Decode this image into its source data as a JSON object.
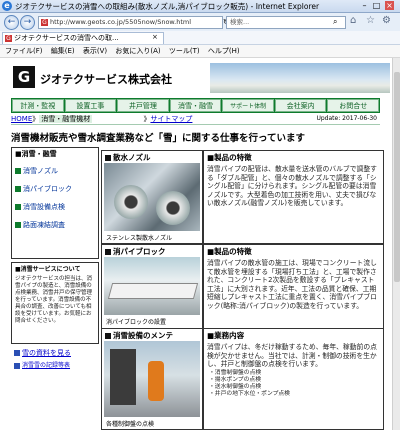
{
  "window": {
    "title": "ジオテクサービスの消雪への取組み(散水ノズル,消パイブロック販売) - Internet Explorer",
    "tab_title": "ジオテクサービスの消雪への取...",
    "controls": [
      "minimize-icon",
      "maximize-icon",
      "close-icon"
    ]
  },
  "address": {
    "url": "http://www.geots.co.jp/5505now/Snow.html",
    "search_placeholder": "検索..."
  },
  "menu": [
    "ファイル(F)",
    "編集(E)",
    "表示(V)",
    "お気に入り(A)",
    "ツール(T)",
    "ヘルプ(H)"
  ],
  "site": {
    "logo": "G",
    "company": "ジオテクサービス株式会社",
    "nav": [
      "計測・監視",
      "設置工事",
      "井戸管理",
      "消雪・融雪",
      "サポート体制",
      "会社案内",
      "お問合せ"
    ],
    "crumb_home": "HOME",
    "crumb_sep": "》",
    "crumb_current": "消雪・融雪機材",
    "crumb_sitemap": "サイトマップ",
    "update": "Update: 2017-06-30",
    "headline": "消雪機材販売や雪水調査業務など「雪」に関する仕事を行っています"
  },
  "side": {
    "heading": "■消雪・融雪",
    "links": [
      "消雪ノズル",
      "消パイブロック",
      "消雪設備点検",
      "路面凍結調査"
    ],
    "about_heading": "■消雪サービスについて",
    "about_text": "ジオテクサービスの担当は、消雪パイプの製造と、消雪設備の点検業務、消雪井戸の保守管理を行っています。消雪設備の不具合の調査、改善についても相談を受けています。お気軽にお問合せください。",
    "links_bottom": [
      "雪の資料を見る",
      "消雪雪の記録等表"
    ]
  },
  "main": {
    "blocks": [
      {
        "caption": "散水ノズル",
        "img_caption": "ステンレス製散水ノズル",
        "heading": "■製品の特徴",
        "text": "消雪パイプの配管は、散水量を送水管のバルブで調整する「ダブル配管」と、個々の散水ノズルで調整する「シングル配管」に分けられます。シングル配管の要は消雪ノズルです。大型着色の加工技術を用い、丈夫で損びない散水ノズル(融雪ノズル)を販売しています。"
      },
      {
        "caption": "消パイブロック",
        "img_caption": "消パイブロックの設置",
        "heading": "■製品の特徴",
        "text": "消雪パイプの散水管の施工は、現場でコンクリート流して散水管を埋設する「現場打ち工法」と、工場で製作された、コンクリート2次製品を敷設する「プレキャスト工法」に大別されます。近年、工法の品質と確保、工期短縮しプレキャスト工法に重点を置く、消雪パイプブロック(略称:消パイブロック)の製造を行っています。"
      },
      {
        "caption": "消雪設備のメンテ",
        "img_caption": "各種制御盤の点検",
        "heading": "■業務内容",
        "text": "消雪パイプは、冬だけ稼動するため、毎年、稼動前の点検が欠かせません。当社では、計測・制御の技術を生かし、井戸と制御盤の点検を行います。",
        "list": [
          "・消雪制御盤の点検",
          "・揚水ポンプの点検",
          "・送水制御盤の点検",
          "・井戸の地下水位・ポンプ点検"
        ]
      }
    ]
  }
}
